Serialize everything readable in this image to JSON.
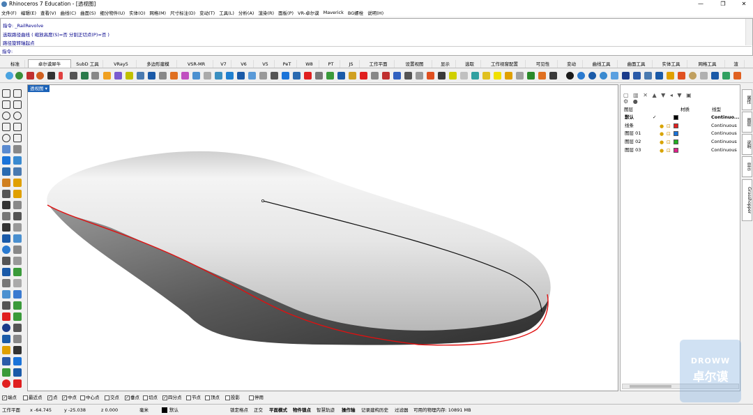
{
  "app": {
    "title": "Rhinoceros 7 Education - [透视图]"
  },
  "menu": [
    "文件(F)",
    "编辑(E)",
    "查看(V)",
    "曲线(C)",
    "曲面(S)",
    "细分物件(U)",
    "实体(O)",
    "网格(M)",
    "尺寸标注(D)",
    "变动(T)",
    "工具(L)",
    "分析(A)",
    "渲染(R)",
    "面板(P)",
    "VR-卓尔谟",
    "Maverick",
    "BG螺栓",
    "说明(H)"
  ],
  "command": {
    "lines": [
      "指令: _RailRevolve",
      "选取路径曲线 ( 缩放高度(S)=否  分割正切点(P)=否 )",
      "路径旋转轴起点"
    ],
    "prompt_label": "指令:"
  },
  "tabs": [
    "标准",
    "卓尔谟犀牛",
    "SubD 工具",
    "VRay5",
    "多边形建模",
    "VSR-MR",
    "V7",
    "V6",
    "V5",
    "PeT",
    "W8",
    "PT",
    "JS",
    "工作平面",
    "设置视图",
    "显示",
    "选取",
    "工作视窗配置",
    "可见性",
    "变动",
    "曲线工具",
    "曲面工具",
    "实体工具",
    "网格工具",
    "渲"
  ],
  "active_tab": "卓尔谟犀牛",
  "viewport": {
    "label": "透视图"
  },
  "layers": {
    "headers": {
      "name": "图层",
      "material": "材质",
      "linetype": "线型"
    },
    "rows": [
      {
        "name": "默认",
        "check": "✓",
        "color": "#000000",
        "linetype": "Continuo...",
        "bold": true
      },
      {
        "name": "线条",
        "check": "",
        "color": "#e02020",
        "linetype": "Continuous",
        "bold": false
      },
      {
        "name": "图层 01",
        "check": "",
        "color": "#1a73d9",
        "linetype": "Continuous",
        "bold": false
      },
      {
        "name": "图层 02",
        "check": "",
        "color": "#22b022",
        "linetype": "Continuous",
        "bold": false
      },
      {
        "name": "图层 03",
        "check": "",
        "color": "#e0208a",
        "linetype": "Continuous",
        "bold": false
      }
    ]
  },
  "side_tabs": [
    "属性",
    "图层",
    "说明",
    "显示",
    "Grasshopper"
  ],
  "osnap": [
    {
      "label": "端点",
      "checked": true
    },
    {
      "label": "最近点",
      "checked": false
    },
    {
      "label": "点",
      "checked": true
    },
    {
      "label": "中点",
      "checked": true
    },
    {
      "label": "中心点",
      "checked": false
    },
    {
      "label": "交点",
      "checked": false
    },
    {
      "label": "垂点",
      "checked": true
    },
    {
      "label": "切点",
      "checked": false
    },
    {
      "label": "四分点",
      "checked": true
    },
    {
      "label": "节点",
      "checked": false
    },
    {
      "label": "顶点",
      "checked": false
    },
    {
      "label": "投影",
      "checked": false
    },
    {
      "label": "停用",
      "checked": false
    }
  ],
  "status": {
    "plane": "工作平面",
    "x": "x -64.745",
    "y": "y -25.038",
    "z": "z 0.000",
    "unit": "毫米",
    "layer": "默认",
    "lock": "锁定格点",
    "ortho": "正交",
    "planar": "平面模式",
    "objsnap": "物件锁点",
    "smarttrack": "智慧轨迹",
    "gumball": "操作轴",
    "history": "记录建构历史",
    "filter": "过滤器",
    "memory": "可用的物理内存: 10891 MB"
  },
  "watermark": {
    "line1": "DROWW",
    "line2": "卓尔谟"
  }
}
